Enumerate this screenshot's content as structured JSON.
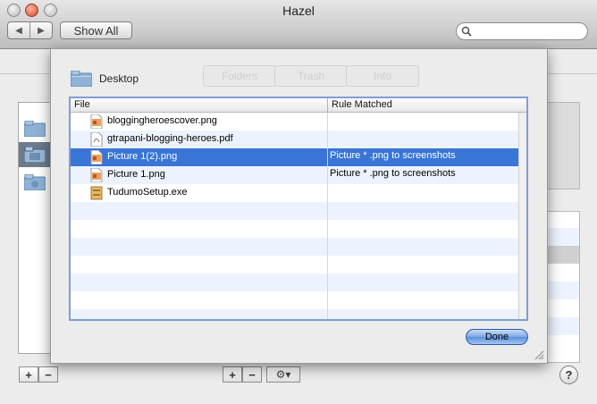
{
  "window": {
    "title": "Hazel"
  },
  "toolbar": {
    "back_icon": "triangle-left",
    "forward_icon": "triangle-right",
    "show_all_label": "Show All",
    "search_value": ""
  },
  "sheet": {
    "folder_name": "Desktop",
    "ghost_tabs": [
      "Folders",
      "Trash",
      "Info"
    ],
    "columns": {
      "file": "File",
      "rule": "Rule Matched"
    },
    "rows": [
      {
        "file": "bloggingheroescover.png",
        "rule": "",
        "icon": "png-file-icon"
      },
      {
        "file": "gtrapani-blogging-heroes.pdf",
        "rule": "",
        "icon": "pdf-file-icon"
      },
      {
        "file": "Picture 1(2).png",
        "rule": "Picture * .png to screenshots",
        "icon": "png-file-icon",
        "selected": true
      },
      {
        "file": "Picture 1.png",
        "rule": "Picture * .png to screenshots",
        "icon": "png-file-icon"
      },
      {
        "file": "TudumoSetup.exe",
        "rule": "",
        "icon": "exe-file-icon"
      }
    ],
    "done_label": "Done"
  },
  "bottom": {
    "add_label": "+",
    "remove_label": "−",
    "add2_label": "+",
    "remove2_label": "−",
    "gear_label": "⚙▾",
    "help_label": "?"
  },
  "colors": {
    "selection": "#3875d7",
    "stripe": "#edf3fe",
    "focus_ring": "#7f9ed5"
  }
}
